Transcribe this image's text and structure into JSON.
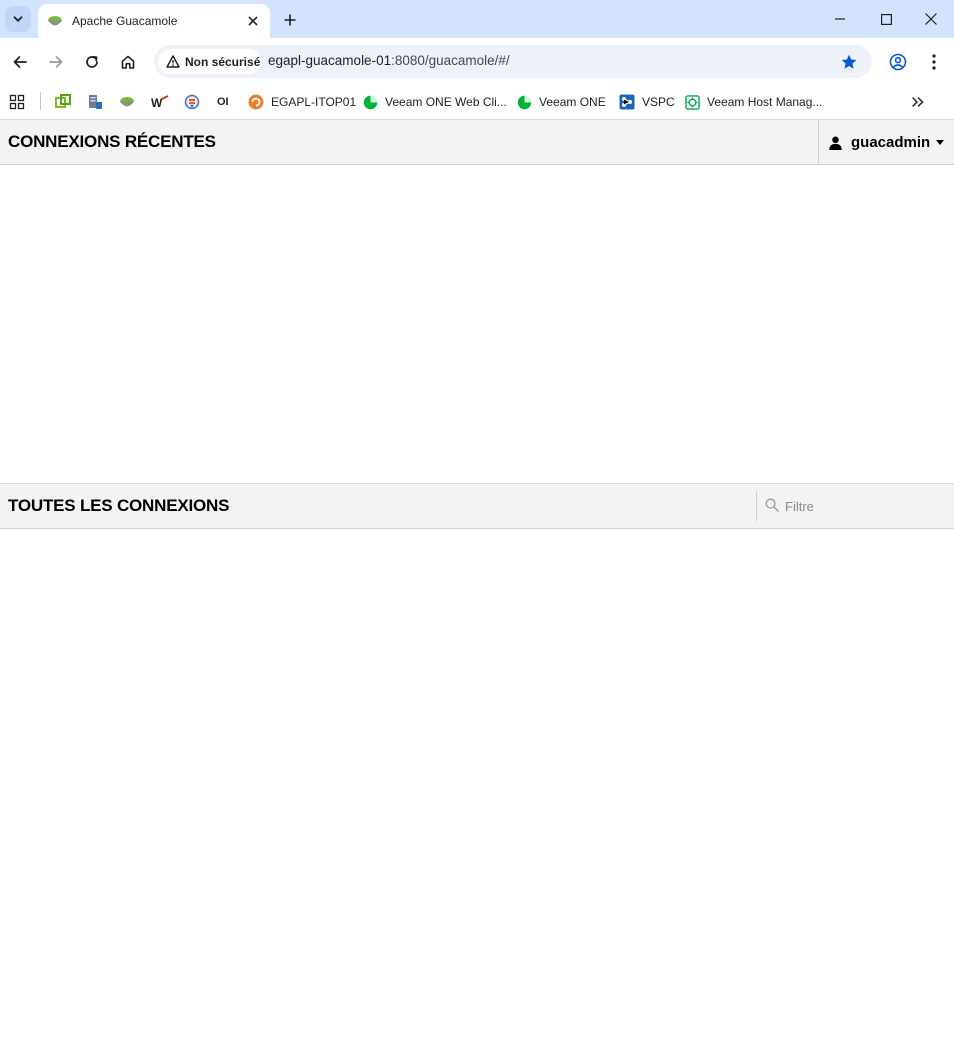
{
  "browser": {
    "tab": {
      "title": "Apache Guacamole"
    },
    "omnibox": {
      "security_label": "Non sécurisé",
      "url_host": "egapl-guacamole-01",
      "url_rest": ":8080/guacamole/#/"
    },
    "bookmarks": [
      {
        "label": "",
        "icon": "vsphere-icon"
      },
      {
        "label": "",
        "icon": "server-icon"
      },
      {
        "label": "",
        "icon": "guacamole-icon"
      },
      {
        "label": "",
        "icon": "w-logo-icon"
      },
      {
        "label": "",
        "icon": "jenkins-icon"
      },
      {
        "label": "",
        "icon": "oi-icon"
      },
      {
        "label": "EGAPL-ITOP01",
        "icon": "itop-icon"
      },
      {
        "label": "Veeam ONE Web Cli...",
        "icon": "veeam-one-icon"
      },
      {
        "label": "Veeam ONE",
        "icon": "veeam-one-icon"
      },
      {
        "label": "VSPC",
        "icon": "vspc-icon"
      },
      {
        "label": "Veeam Host Manag...",
        "icon": "veeam-host-icon"
      }
    ],
    "bookmark_oi_text": "OI"
  },
  "guacamole": {
    "recent_title": "CONNEXIONS RÉCENTES",
    "all_title": "TOUTES LES CONNEXIONS",
    "username": "guacadmin",
    "filter_placeholder": "Filtre"
  },
  "colors": {
    "titlebar": "#d3e3fd",
    "omnibox": "#edf2fa",
    "header_bg": "#f3f3f3",
    "star": "#0b57d0"
  }
}
